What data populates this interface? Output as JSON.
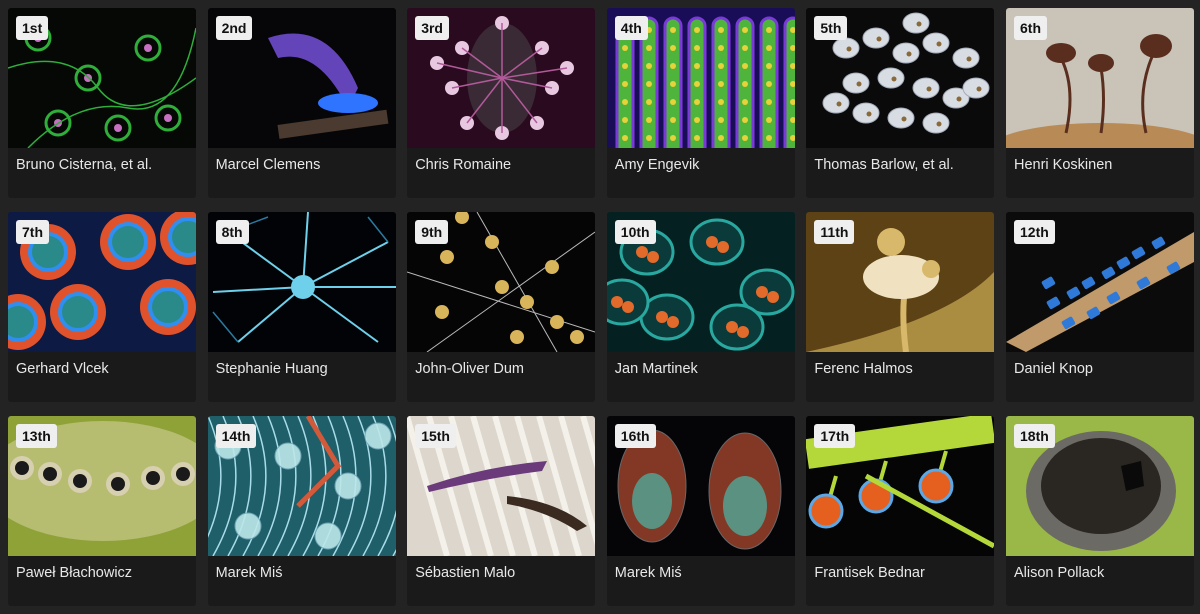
{
  "entries": [
    {
      "rank": "1st",
      "name": "Bruno Cisterna, et al.",
      "colors": [
        "#050805",
        "#2fae3a",
        "#c76fc0"
      ]
    },
    {
      "rank": "2nd",
      "name": "Marcel Clemens",
      "colors": [
        "#060608",
        "#7b54e6",
        "#2e74ff"
      ]
    },
    {
      "rank": "3rd",
      "name": "Chris Romaine",
      "colors": [
        "#2a0a1e",
        "#b15a9a",
        "#e8c8e0"
      ]
    },
    {
      "rank": "4th",
      "name": "Amy Engevik",
      "colors": [
        "#1a0d57",
        "#4fb43c",
        "#e6d23a"
      ]
    },
    {
      "rank": "5th",
      "name": "Thomas Barlow, et al.",
      "colors": [
        "#0a0a0a",
        "#d8dde4",
        "#a5acb8"
      ]
    },
    {
      "rank": "6th",
      "name": "Henri Koskinen",
      "colors": [
        "#c9c3b8",
        "#5a2e1e",
        "#b88a55"
      ]
    },
    {
      "rank": "7th",
      "name": "Gerhard Vlcek",
      "colors": [
        "#0c1a44",
        "#e0522c",
        "#2f8ff0"
      ]
    },
    {
      "rank": "8th",
      "name": "Stephanie Huang",
      "colors": [
        "#020306",
        "#6ed0ea",
        "#2a7aa0"
      ]
    },
    {
      "rank": "9th",
      "name": "John-Oliver Dum",
      "colors": [
        "#050505",
        "#d8b45a",
        "#bababa"
      ]
    },
    {
      "rank": "10th",
      "name": "Jan Martinek",
      "colors": [
        "#052020",
        "#29a8a0",
        "#e26a2a"
      ]
    },
    {
      "rank": "11th",
      "name": "Ferenc Halmos",
      "colors": [
        "#5c4214",
        "#d8b86a",
        "#f0e2c0"
      ]
    },
    {
      "rank": "12th",
      "name": "Daniel Knop",
      "colors": [
        "#0b0b0b",
        "#2f7ad8",
        "#c09a6a"
      ]
    },
    {
      "rank": "13th",
      "name": "Paweł Błachowicz",
      "colors": [
        "#8ea238",
        "#d6d0b0",
        "#1a1a1a"
      ]
    },
    {
      "rank": "14th",
      "name": "Marek Miś",
      "colors": [
        "#1f5f6a",
        "#d25a3a",
        "#a8dce8"
      ]
    },
    {
      "rank": "15th",
      "name": "Sébastien Malo",
      "colors": [
        "#dcd6cc",
        "#6a3a7a",
        "#3a2a20"
      ]
    },
    {
      "rank": "16th",
      "name": "Marek Miś",
      "colors": [
        "#050508",
        "#d85a3a",
        "#4ab8a8"
      ]
    },
    {
      "rank": "17th",
      "name": "Frantisek Bednar",
      "colors": [
        "#050505",
        "#b4d83a",
        "#e5601e"
      ]
    },
    {
      "rank": "18th",
      "name": "Alison Pollack",
      "colors": [
        "#9ab848",
        "#6c6a64",
        "#2a2622"
      ]
    }
  ]
}
